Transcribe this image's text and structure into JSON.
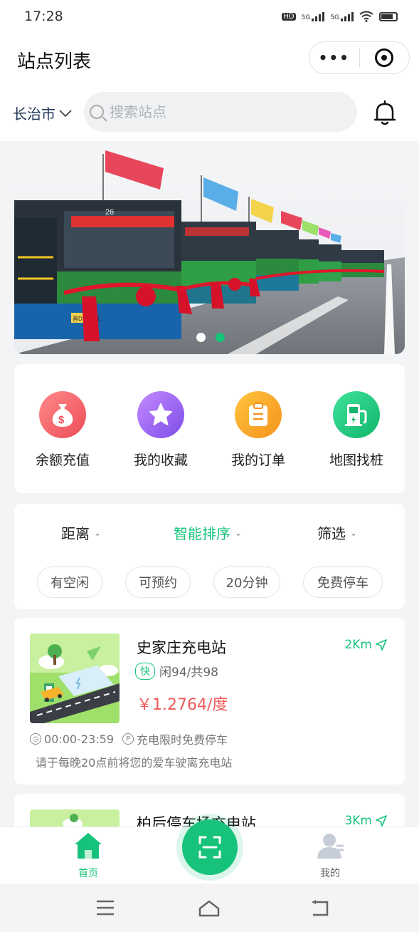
{
  "status": {
    "time": "17:28",
    "hd": "HD",
    "net1": "5G",
    "net2": "5G"
  },
  "header": {
    "title": "站点列表",
    "more_icon": "more-dots-icon",
    "close_icon": "target-close-icon"
  },
  "search": {
    "city": "长治市",
    "placeholder": "搜索站点"
  },
  "banner": {
    "bus_number": "26",
    "plate": "晋D·07851",
    "slides": 2,
    "active_slide": 2
  },
  "quick": [
    {
      "label": "余额充值",
      "icon": "money-bag-icon",
      "color": "#f36a6a"
    },
    {
      "label": "我的收藏",
      "icon": "star-icon",
      "color": "#9b5cf0"
    },
    {
      "label": "我的订单",
      "icon": "clipboard-icon",
      "color": "#f7a21c"
    },
    {
      "label": "地图找桩",
      "icon": "charging-pile-icon",
      "color": "#17c37b"
    }
  ],
  "sort": {
    "distance": "距离",
    "smart": "智能排序",
    "filter": "筛选"
  },
  "chips": [
    "有空闲",
    "可预约",
    "20分钟",
    "免费停车"
  ],
  "stations": [
    {
      "name": "史家庄充电站",
      "distance": "2Km",
      "fast": "快",
      "availability": "闲94/共98",
      "price": "￥1.2764/度",
      "hours": "00:00-23:59",
      "parking": "充电限时免费停车",
      "note": "请于每晚20点前将您的爱车驶离充电站"
    },
    {
      "name": "柏后停车场充电站",
      "distance": "3Km"
    }
  ],
  "tabbar": {
    "home": "首页",
    "mine": "我的"
  },
  "colors": {
    "brand": "#17c37b",
    "price": "#ef5a5a"
  }
}
